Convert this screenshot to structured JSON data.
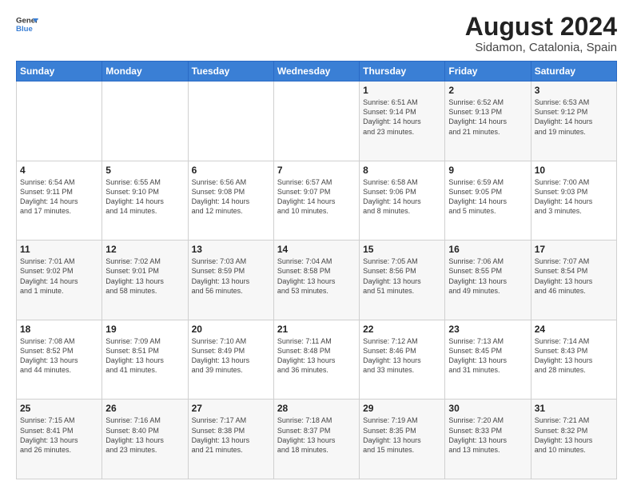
{
  "logo": {
    "line1": "General",
    "line2": "Blue"
  },
  "title": "August 2024",
  "subtitle": "Sidamon, Catalonia, Spain",
  "days_of_week": [
    "Sunday",
    "Monday",
    "Tuesday",
    "Wednesday",
    "Thursday",
    "Friday",
    "Saturday"
  ],
  "weeks": [
    [
      {
        "day": "",
        "info": ""
      },
      {
        "day": "",
        "info": ""
      },
      {
        "day": "",
        "info": ""
      },
      {
        "day": "",
        "info": ""
      },
      {
        "day": "1",
        "info": "Sunrise: 6:51 AM\nSunset: 9:14 PM\nDaylight: 14 hours\nand 23 minutes."
      },
      {
        "day": "2",
        "info": "Sunrise: 6:52 AM\nSunset: 9:13 PM\nDaylight: 14 hours\nand 21 minutes."
      },
      {
        "day": "3",
        "info": "Sunrise: 6:53 AM\nSunset: 9:12 PM\nDaylight: 14 hours\nand 19 minutes."
      }
    ],
    [
      {
        "day": "4",
        "info": "Sunrise: 6:54 AM\nSunset: 9:11 PM\nDaylight: 14 hours\nand 17 minutes."
      },
      {
        "day": "5",
        "info": "Sunrise: 6:55 AM\nSunset: 9:10 PM\nDaylight: 14 hours\nand 14 minutes."
      },
      {
        "day": "6",
        "info": "Sunrise: 6:56 AM\nSunset: 9:08 PM\nDaylight: 14 hours\nand 12 minutes."
      },
      {
        "day": "7",
        "info": "Sunrise: 6:57 AM\nSunset: 9:07 PM\nDaylight: 14 hours\nand 10 minutes."
      },
      {
        "day": "8",
        "info": "Sunrise: 6:58 AM\nSunset: 9:06 PM\nDaylight: 14 hours\nand 8 minutes."
      },
      {
        "day": "9",
        "info": "Sunrise: 6:59 AM\nSunset: 9:05 PM\nDaylight: 14 hours\nand 5 minutes."
      },
      {
        "day": "10",
        "info": "Sunrise: 7:00 AM\nSunset: 9:03 PM\nDaylight: 14 hours\nand 3 minutes."
      }
    ],
    [
      {
        "day": "11",
        "info": "Sunrise: 7:01 AM\nSunset: 9:02 PM\nDaylight: 14 hours\nand 1 minute."
      },
      {
        "day": "12",
        "info": "Sunrise: 7:02 AM\nSunset: 9:01 PM\nDaylight: 13 hours\nand 58 minutes."
      },
      {
        "day": "13",
        "info": "Sunrise: 7:03 AM\nSunset: 8:59 PM\nDaylight: 13 hours\nand 56 minutes."
      },
      {
        "day": "14",
        "info": "Sunrise: 7:04 AM\nSunset: 8:58 PM\nDaylight: 13 hours\nand 53 minutes."
      },
      {
        "day": "15",
        "info": "Sunrise: 7:05 AM\nSunset: 8:56 PM\nDaylight: 13 hours\nand 51 minutes."
      },
      {
        "day": "16",
        "info": "Sunrise: 7:06 AM\nSunset: 8:55 PM\nDaylight: 13 hours\nand 49 minutes."
      },
      {
        "day": "17",
        "info": "Sunrise: 7:07 AM\nSunset: 8:54 PM\nDaylight: 13 hours\nand 46 minutes."
      }
    ],
    [
      {
        "day": "18",
        "info": "Sunrise: 7:08 AM\nSunset: 8:52 PM\nDaylight: 13 hours\nand 44 minutes."
      },
      {
        "day": "19",
        "info": "Sunrise: 7:09 AM\nSunset: 8:51 PM\nDaylight: 13 hours\nand 41 minutes."
      },
      {
        "day": "20",
        "info": "Sunrise: 7:10 AM\nSunset: 8:49 PM\nDaylight: 13 hours\nand 39 minutes."
      },
      {
        "day": "21",
        "info": "Sunrise: 7:11 AM\nSunset: 8:48 PM\nDaylight: 13 hours\nand 36 minutes."
      },
      {
        "day": "22",
        "info": "Sunrise: 7:12 AM\nSunset: 8:46 PM\nDaylight: 13 hours\nand 33 minutes."
      },
      {
        "day": "23",
        "info": "Sunrise: 7:13 AM\nSunset: 8:45 PM\nDaylight: 13 hours\nand 31 minutes."
      },
      {
        "day": "24",
        "info": "Sunrise: 7:14 AM\nSunset: 8:43 PM\nDaylight: 13 hours\nand 28 minutes."
      }
    ],
    [
      {
        "day": "25",
        "info": "Sunrise: 7:15 AM\nSunset: 8:41 PM\nDaylight: 13 hours\nand 26 minutes."
      },
      {
        "day": "26",
        "info": "Sunrise: 7:16 AM\nSunset: 8:40 PM\nDaylight: 13 hours\nand 23 minutes."
      },
      {
        "day": "27",
        "info": "Sunrise: 7:17 AM\nSunset: 8:38 PM\nDaylight: 13 hours\nand 21 minutes."
      },
      {
        "day": "28",
        "info": "Sunrise: 7:18 AM\nSunset: 8:37 PM\nDaylight: 13 hours\nand 18 minutes."
      },
      {
        "day": "29",
        "info": "Sunrise: 7:19 AM\nSunset: 8:35 PM\nDaylight: 13 hours\nand 15 minutes."
      },
      {
        "day": "30",
        "info": "Sunrise: 7:20 AM\nSunset: 8:33 PM\nDaylight: 13 hours\nand 13 minutes."
      },
      {
        "day": "31",
        "info": "Sunrise: 7:21 AM\nSunset: 8:32 PM\nDaylight: 13 hours\nand 10 minutes."
      }
    ]
  ]
}
